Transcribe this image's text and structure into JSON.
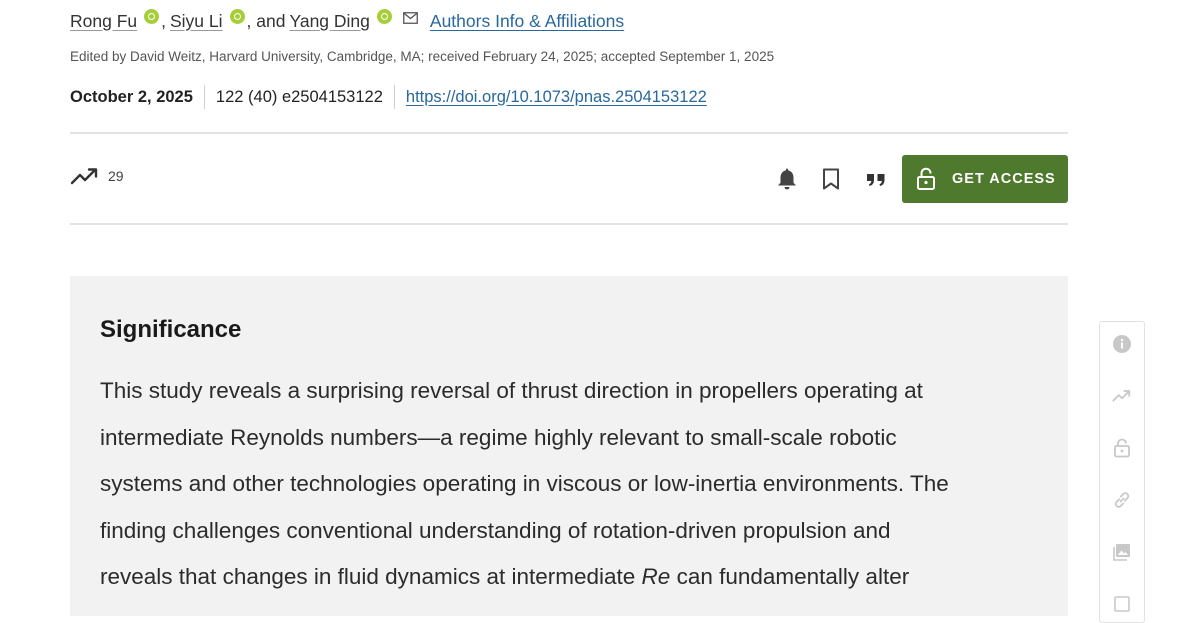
{
  "authors": {
    "list": [
      {
        "name": "Rong Fu",
        "separator": ","
      },
      {
        "name": "Siyu Li",
        "separator": ", and"
      },
      {
        "name": "Yang Ding",
        "separator": ""
      }
    ],
    "affiliations_link": "Authors Info & Affiliations"
  },
  "edited_line": "Edited by David Weitz, Harvard University, Cambridge, MA; received February 24, 2025; accepted September 1, 2025",
  "meta": {
    "date": "October 2, 2025",
    "citation": "122 (40) e2504153122",
    "doi": "https://doi.org/10.1073/pnas.2504153122"
  },
  "toolbar": {
    "metrics_count": "29",
    "get_access_label": "GET ACCESS"
  },
  "significance": {
    "title": "Significance",
    "lines": [
      "This study reveals a surprising reversal of thrust direction in propellers operating at",
      "intermediate Reynolds numbers—a regime highly relevant to small-scale robotic",
      "systems and other technologies operating in viscous or low-inertia environments. The",
      "finding challenges conventional understanding of rotation-driven propulsion and"
    ],
    "last_line_before": "reveals that changes in fluid dynamics at intermediate ",
    "last_line_italic": "Re",
    "last_line_after": " can fundamentally alter"
  },
  "icons": {
    "orcid": "orcid-icon",
    "mail": "mail-icon",
    "metrics": "trending-up-icon",
    "alert": "bell-icon",
    "bookmark": "bookmark-icon",
    "cite": "quote-icon",
    "lock": "lock-icon",
    "rail": [
      "info-icon",
      "trending-up-icon",
      "lock-icon",
      "link-icon",
      "images-icon"
    ]
  },
  "colors": {
    "link": "#29689c",
    "access_button": "#4f7a2e",
    "orcid": "#a6ce39",
    "panel_bg": "#f2f2f2"
  }
}
